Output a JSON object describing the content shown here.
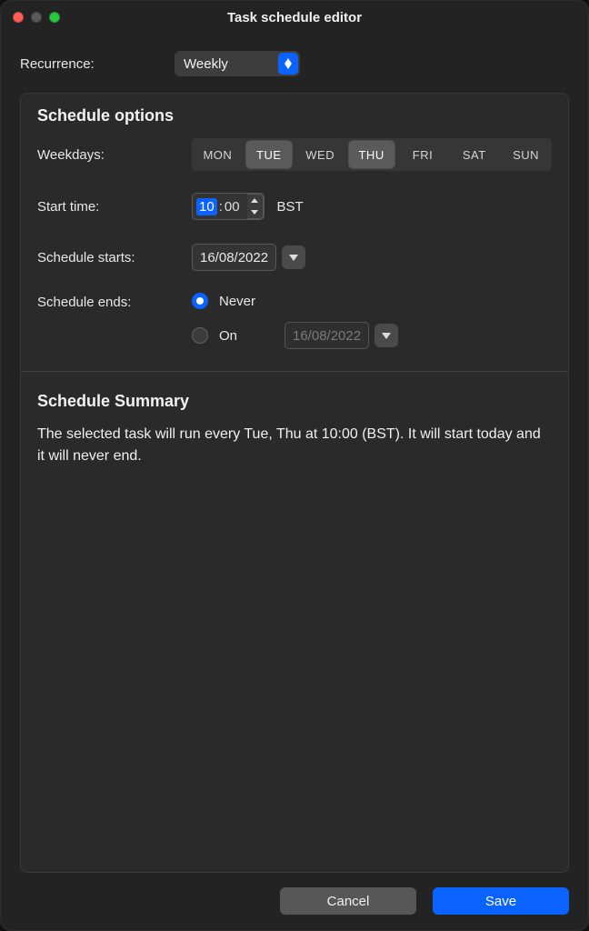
{
  "window": {
    "title": "Task schedule editor"
  },
  "recurrence": {
    "label": "Recurrence:",
    "value": "Weekly"
  },
  "schedule_options": {
    "title": "Schedule options",
    "weekdays_label": "Weekdays:",
    "weekdays": [
      {
        "abbr": "MON",
        "selected": false
      },
      {
        "abbr": "TUE",
        "selected": true
      },
      {
        "abbr": "WED",
        "selected": false
      },
      {
        "abbr": "THU",
        "selected": true
      },
      {
        "abbr": "FRI",
        "selected": false
      },
      {
        "abbr": "SAT",
        "selected": false
      },
      {
        "abbr": "SUN",
        "selected": false
      }
    ],
    "start_time_label": "Start time:",
    "start_time": {
      "hh": "10",
      "mm": "00",
      "tz": "BST"
    },
    "schedule_starts_label": "Schedule starts:",
    "schedule_starts_value": "16/08/2022",
    "schedule_ends_label": "Schedule ends:",
    "ends": {
      "mode": "never",
      "never_label": "Never",
      "on_label": "On",
      "on_value": "16/08/2022"
    }
  },
  "summary": {
    "title": "Schedule Summary",
    "text": "The selected task will run every Tue, Thu at 10:00 (BST). It will start today and it will never end."
  },
  "footer": {
    "cancel": "Cancel",
    "save": "Save"
  }
}
